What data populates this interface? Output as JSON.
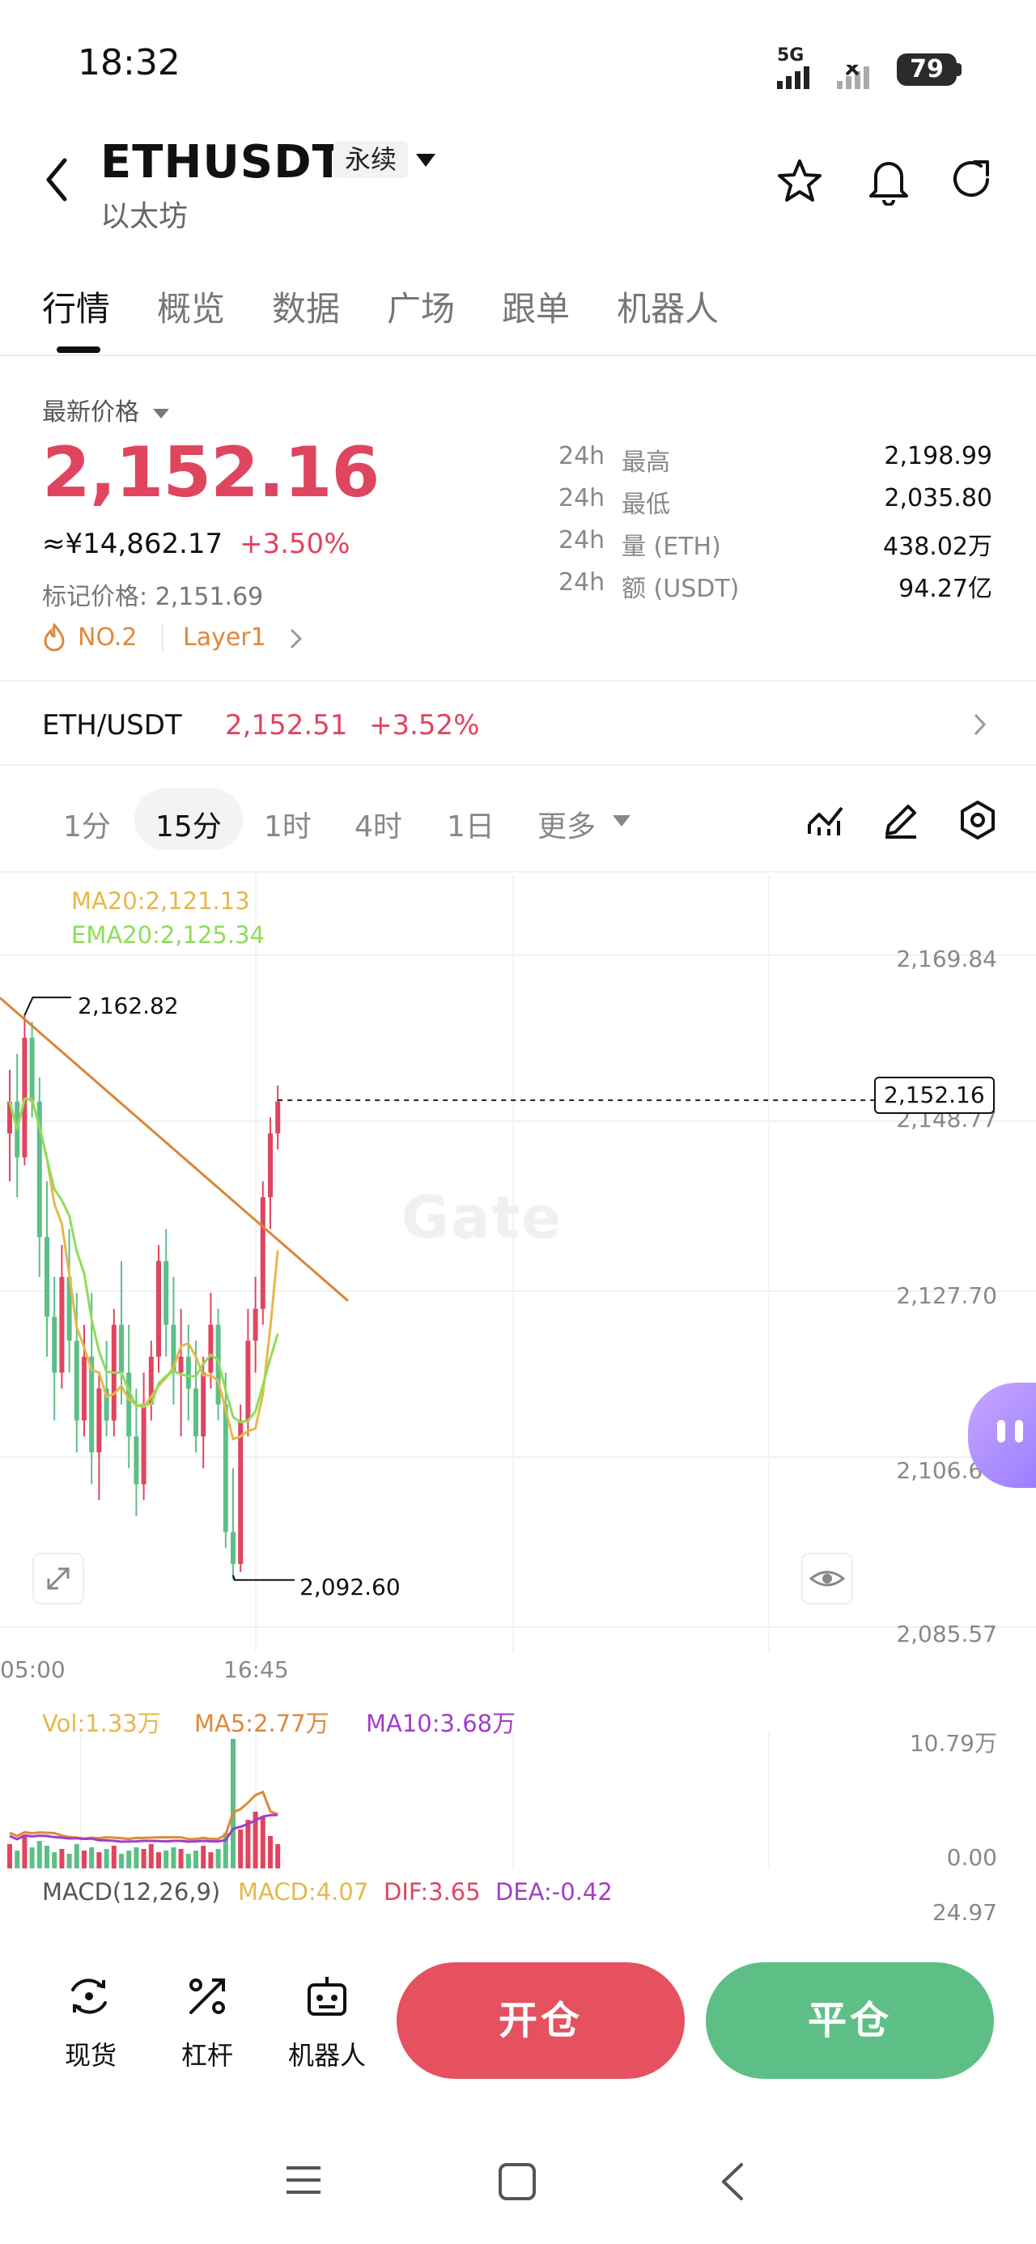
{
  "status_bar": {
    "time": "18:32",
    "network": "5G",
    "battery": "79"
  },
  "header": {
    "symbol": "ETHUSDT",
    "contract_type": "永续",
    "name": "以太坊"
  },
  "tabs": [
    "行情",
    "概览",
    "数据",
    "广场",
    "跟单",
    "机器人"
  ],
  "price": {
    "label": "最新价格",
    "last": "2,152.16",
    "cny": "≈¥14,862.17",
    "change": "+3.50%",
    "mark": "标记价格: 2,151.69",
    "rank_tag": "NO.2",
    "sector_tag": "Layer1"
  },
  "stats": [
    {
      "period": "24h",
      "name": "最高",
      "value": "2,198.99"
    },
    {
      "period": "24h",
      "name": "最低",
      "value": "2,035.80"
    },
    {
      "period": "24h",
      "name": "量 (ETH)",
      "value": "438.02万"
    },
    {
      "period": "24h",
      "name": "额 (USDT)",
      "value": "94.27亿"
    }
  ],
  "spot": {
    "pair": "ETH/USDT",
    "price": "2,152.51",
    "change": "+3.52%"
  },
  "timeframes": [
    "1分",
    "15分",
    "1时",
    "4时",
    "1日",
    "更多"
  ],
  "chart": {
    "ma20": "MA20:2,121.13",
    "ema20": "EMA20:2,125.34",
    "y_ticks": [
      "2,169.84",
      "2,148.77",
      "2,127.70",
      "2,106.64",
      "2,085.57"
    ],
    "high_label": "2,162.82",
    "low_label": "2,092.60",
    "current_tag": "2,152.16",
    "x_ticks": [
      "05:00",
      "16:45"
    ],
    "watermark": "Gate"
  },
  "volume": {
    "vol": "Vol:1.33万",
    "ma5": "MA5:2.77万",
    "ma10": "MA10:3.68万",
    "y_top": "10.79万",
    "y_bottom": "0.00"
  },
  "macd": {
    "label": "MACD(12,26,9)",
    "macd": "MACD:4.07",
    "dif": "DIF:3.65",
    "dea": "DEA:-0.42",
    "y_top": "24.97"
  },
  "actions": {
    "spot": "现货",
    "leverage": "杠杆",
    "bot": "机器人",
    "open": "开仓",
    "close": "平仓"
  },
  "colors": {
    "up": "#e0455f",
    "down": "#5dbf86",
    "ma20": "#e6b84a",
    "ema20": "#8fdc5a",
    "ma10": "#a23ec6"
  }
}
